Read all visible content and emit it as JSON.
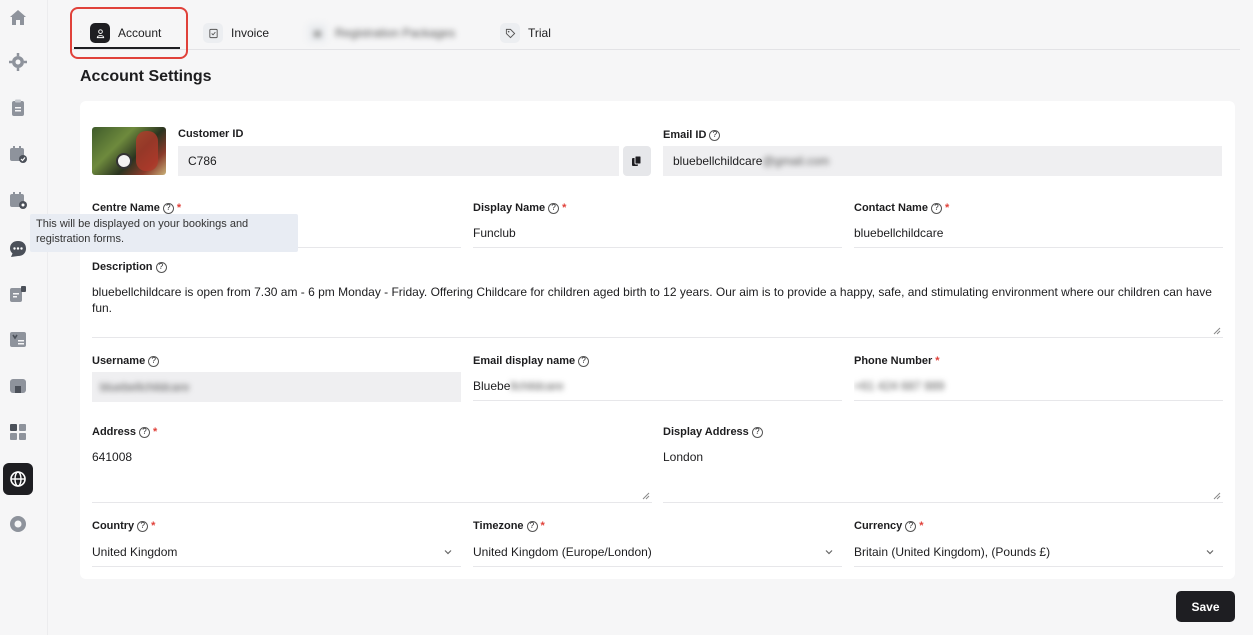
{
  "tabs": [
    {
      "label": "Account",
      "icon": "user-icon"
    },
    {
      "label": "Invoice",
      "icon": "invoice-icon"
    },
    {
      "label": "Registration Packages",
      "icon": "package-icon"
    },
    {
      "label": "Trial",
      "icon": "tag-icon"
    }
  ],
  "page_title": "Account Settings",
  "account": {
    "customer_id_label": "Customer ID",
    "customer_id": "C786",
    "email_id_label": "Email ID",
    "email_id_visible": "bluebellchildcare",
    "email_id_hidden": "@gmail.com",
    "centre_name_label": "Centre Name",
    "display_name_label": "Display Name",
    "display_name": "Funclub",
    "contact_name_label": "Contact Name",
    "contact_name": "bluebellchildcare",
    "description_label": "Description",
    "description": "bluebellchildcare is open from 7.30 am - 6 pm Monday - Friday.  Offering Childcare for children aged birth to 12 years. Our aim is to provide a happy, safe, and stimulating environment where our children can have fun.",
    "username_label": "Username",
    "username_hidden": "bluebellchildcare",
    "email_display_name_label": "Email display name",
    "email_display_name_visible": "Bluebe",
    "email_display_name_hidden": "llchildcare",
    "phone_label": "Phone Number",
    "phone_hidden": "+61 424 687 889",
    "address_label": "Address",
    "address": "641008",
    "display_address_label": "Display Address",
    "display_address": "London",
    "country_label": "Country",
    "country": "United Kingdom",
    "timezone_label": "Timezone",
    "timezone": "United Kingdom (Europe/London)",
    "currency_label": "Currency",
    "currency": "Britain (United Kingdom), (Pounds £)"
  },
  "tooltip": "This will be displayed on your bookings and registration forms.",
  "save_label": "Save",
  "sidebar_icons": [
    "home-icon",
    "settings-icon",
    "clipboard-icon",
    "calendar-check-icon",
    "calendar-settings-icon",
    "chat-icon",
    "notes-icon",
    "checklist-icon",
    "store-icon",
    "grid-icon",
    "globe-icon",
    "support-icon"
  ],
  "colors": {
    "accent": "#1e1e22",
    "required": "#e0413a",
    "highlight": "#e0413a",
    "tooltip_bg": "#e8ecf3"
  }
}
